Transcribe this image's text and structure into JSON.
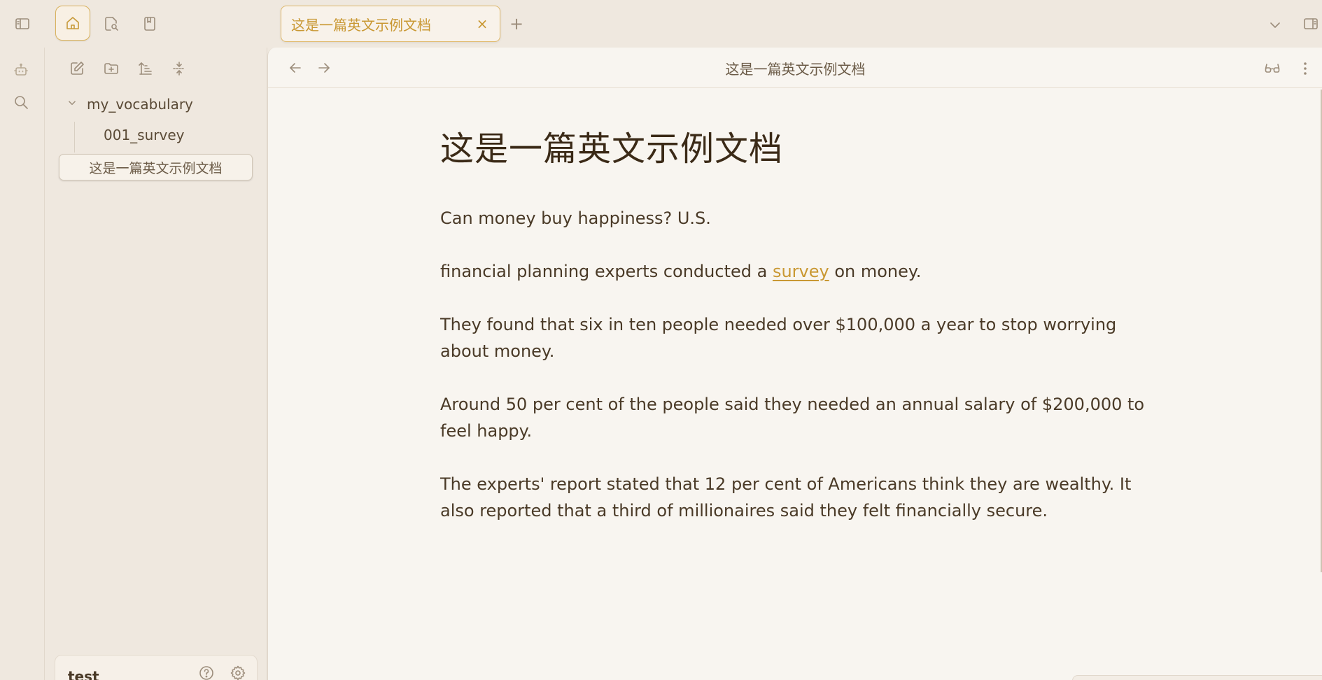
{
  "tab": {
    "title": "这是一篇英文示例文档",
    "close": "×",
    "new_tab": "+"
  },
  "header": {
    "title": "这是一篇英文示例文档"
  },
  "explorer": {
    "folder": {
      "name": "my_vocabulary"
    },
    "files": [
      {
        "name": "001_survey"
      },
      {
        "name": "这是一篇英文示例文档"
      }
    ]
  },
  "vault": {
    "name": "test"
  },
  "document": {
    "title": "这是一篇英文示例文档",
    "paragraphs": [
      "Can money buy happiness? U.S.",
      {
        "before": "financial planning experts conducted a ",
        "link": "survey",
        "after": " on money."
      },
      "They found that six in ten people needed over $100,000 a year to stop worrying about money.",
      "Around 50 per cent of the people said they needed an annual salary of $200,000 to feel happy.",
      "The experts' report stated that 12 per cent of Americans think they are wealthy. It also reported that a third of millionaires said they felt financially secure."
    ]
  },
  "colors": {
    "accent": "#c99833",
    "background": "#efe8df",
    "editor": "#f8f5f0",
    "text": "#4a3a27"
  },
  "icons": {
    "sidebar_toggle": "sidebar-left-icon",
    "home": "home-icon",
    "search_file": "file-search-icon",
    "bookmark": "bookmark-icon",
    "bot": "bot-icon",
    "search": "search-icon",
    "new_note": "edit-icon",
    "new_folder": "folder-plus-icon",
    "sort": "sort-icon",
    "collapse": "collapse-icon",
    "back": "arrow-left-icon",
    "forward": "arrow-right-icon",
    "reading": "glasses-icon",
    "more": "more-vertical-icon",
    "help": "help-icon",
    "settings": "gear-icon",
    "tab_list": "chevron-down-icon",
    "right_sidebar": "sidebar-right-icon"
  }
}
